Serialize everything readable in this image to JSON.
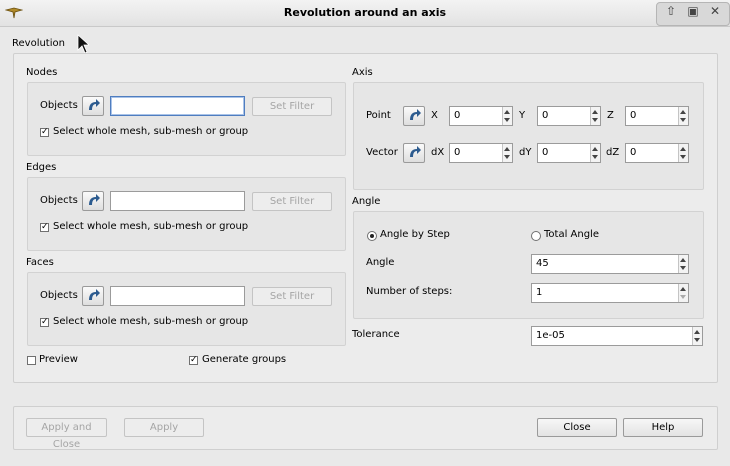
{
  "window": {
    "title": "Revolution around an axis",
    "icons": [
      "app-icon",
      "maximize-up-icon",
      "restore-icon",
      "close-icon"
    ]
  },
  "main_group": {
    "label": "Revolution"
  },
  "nodes": {
    "label": "Nodes",
    "objects_label": "Objects",
    "objects_value": "",
    "filter_label": "Set Filter",
    "whole_mesh_label": "Select whole mesh, sub-mesh or group",
    "whole_mesh_checked": true
  },
  "edges": {
    "label": "Edges",
    "objects_label": "Objects",
    "objects_value": "",
    "filter_label": "Set Filter",
    "whole_mesh_label": "Select whole mesh, sub-mesh or group",
    "whole_mesh_checked": true
  },
  "faces": {
    "label": "Faces",
    "objects_label": "Objects",
    "objects_value": "",
    "filter_label": "Set Filter",
    "whole_mesh_label": "Select whole mesh, sub-mesh or group",
    "whole_mesh_checked": true
  },
  "preview": {
    "label": "Preview",
    "checked": false
  },
  "generate_groups": {
    "label": "Generate groups",
    "checked": true
  },
  "axis": {
    "label": "Axis",
    "point_label": "Point",
    "x_label": "X",
    "y_label": "Y",
    "z_label": "Z",
    "x": "0",
    "y": "0",
    "z": "0",
    "vector_label": "Vector",
    "dx_label": "dX",
    "dy_label": "dY",
    "dz_label": "dZ",
    "dx": "0",
    "dy": "0",
    "dz": "0"
  },
  "angle": {
    "label": "Angle",
    "by_step_label": "Angle by Step",
    "total_label": "Total Angle",
    "mode": "by_step",
    "angle_label": "Angle",
    "angle_value": "45",
    "steps_label": "Number of steps:",
    "steps_value": "1"
  },
  "tolerance": {
    "label": "Tolerance",
    "value": "1e-05"
  },
  "buttons": {
    "apply_close": "Apply and Close",
    "apply": "Apply",
    "close": "Close",
    "help": "Help"
  }
}
